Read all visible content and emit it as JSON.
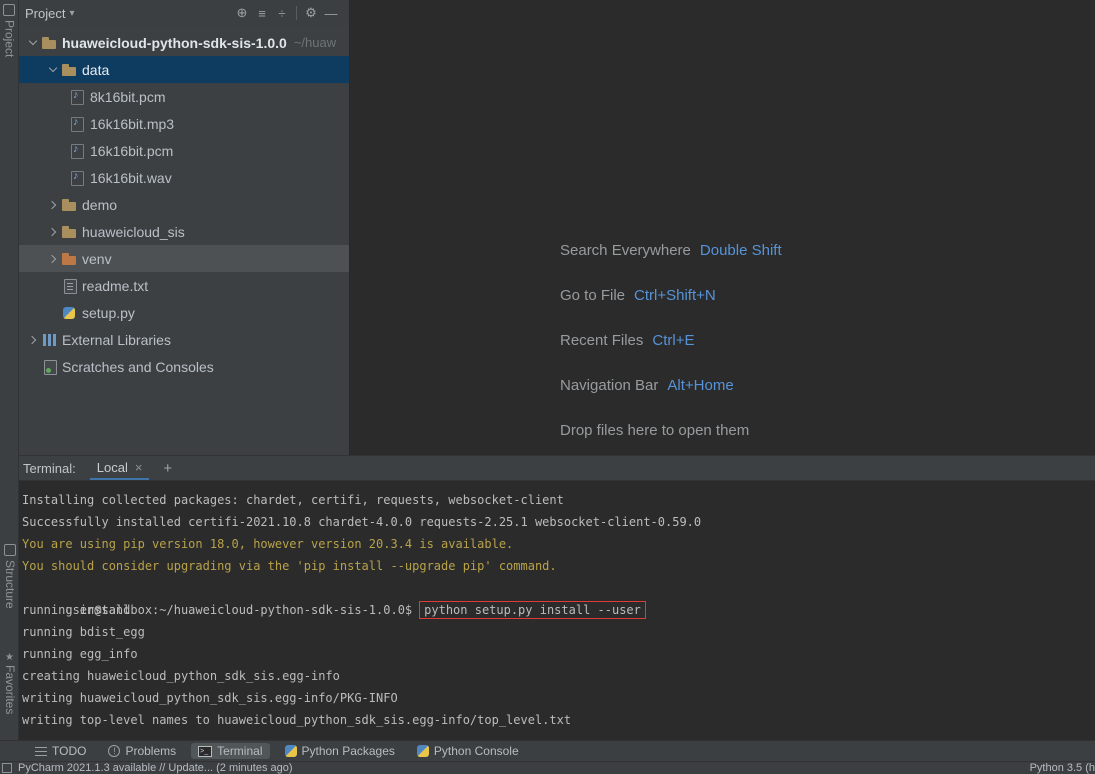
{
  "colors": {
    "panel_bg": "#3c3f41",
    "editor_bg": "#2b2b2b",
    "selection_blue": "#0e3c61",
    "selection_gray": "#4d5153",
    "shortcut_blue": "#5693d8",
    "warning_yellow": "#b8a24a",
    "highlight_red": "#dd3a3a",
    "tab_underline_blue": "#3f74a8"
  },
  "left_strip": {
    "top_label": "Project",
    "structure_label": "Structure",
    "favorites_label": "Favorites",
    "favorites_star": "★"
  },
  "project_panel": {
    "header": {
      "title": "Project",
      "dropdown_glyph": "▾",
      "select_opened_file_glyph": "⊕",
      "expand_all_glyph": "≡",
      "collapse_all_glyph": "÷",
      "settings_glyph": "⚙",
      "hide_glyph": "—"
    },
    "tree": [
      {
        "label": "huaweicloud-python-sdk-sis-1.0.0",
        "hint": "~/huaw"
      },
      {
        "label": "data"
      },
      {
        "label": "8k16bit.pcm"
      },
      {
        "label": "16k16bit.mp3"
      },
      {
        "label": "16k16bit.pcm"
      },
      {
        "label": "16k16bit.wav"
      },
      {
        "label": "demo"
      },
      {
        "label": "huaweicloud_sis"
      },
      {
        "label": "venv"
      },
      {
        "label": "readme.txt"
      },
      {
        "label": "setup.py"
      },
      {
        "label": "External Libraries"
      },
      {
        "label": "Scratches and Consoles"
      }
    ]
  },
  "editor": {
    "shortcuts": [
      {
        "label": "Search Everywhere",
        "keys": "Double Shift"
      },
      {
        "label": "Go to File",
        "keys": "Ctrl+Shift+N"
      },
      {
        "label": "Recent Files",
        "keys": "Ctrl+E"
      },
      {
        "label": "Navigation Bar",
        "keys": "Alt+Home"
      },
      {
        "label": "Drop files here to open them",
        "keys": ""
      }
    ]
  },
  "terminal": {
    "title": "Terminal:",
    "tab_label": "Local",
    "tab_close": "×",
    "new_tab": "+",
    "lines": [
      {
        "text": "Installing collected packages: chardet, certifi, requests, websocket-client"
      },
      {
        "text": "Successfully installed certifi-2021.10.8 chardet-4.0.0 requests-2.25.1 websocket-client-0.59.0"
      },
      {
        "text": "You are using pip version 18.0, however version 20.3.4 is available."
      },
      {
        "text": "You should consider upgrading via the 'pip install --upgrade pip' command."
      },
      {
        "prompt": "user@sandbox:~/huaweicloud-python-sdk-sis-1.0.0$",
        "command": "python setup.py install --user"
      },
      {
        "text": "running install"
      },
      {
        "text": "running bdist_egg"
      },
      {
        "text": "running egg_info"
      },
      {
        "text": "creating huaweicloud_python_sdk_sis.egg-info"
      },
      {
        "text": "writing huaweicloud_python_sdk_sis.egg-info/PKG-INFO"
      },
      {
        "text": "writing top-level names to huaweicloud_python_sdk_sis.egg-info/top_level.txt"
      }
    ]
  },
  "bottom_bar": {
    "items": [
      {
        "label": "TODO"
      },
      {
        "label": "Problems"
      },
      {
        "label": "Terminal"
      },
      {
        "label": "Python Packages"
      },
      {
        "label": "Python Console"
      }
    ],
    "problems_glyph": "!",
    "terminal_glyph": ">_"
  },
  "status_bar": {
    "left": "PyCharm 2021.1.3 available // Update... (2 minutes ago)",
    "right": "Python 3.5 (h"
  }
}
